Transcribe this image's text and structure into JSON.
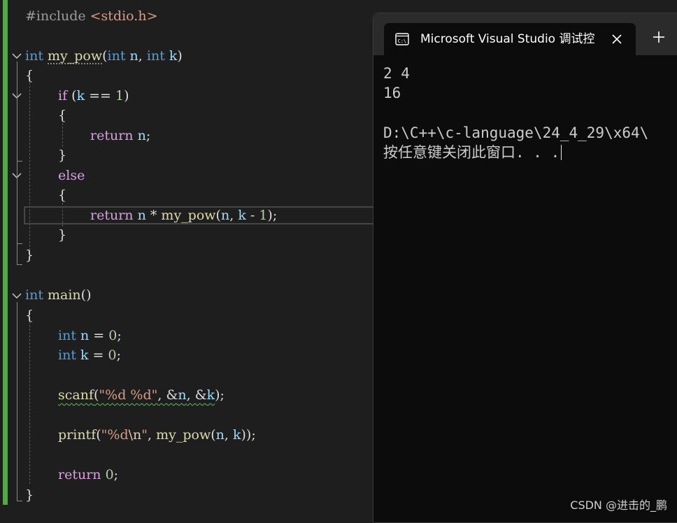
{
  "editor": {
    "lines": {
      "l1": {
        "a": "#include ",
        "b": "<stdio.h>"
      },
      "l3": {
        "a": "int",
        "b": " ",
        "c": "my_pow",
        "d": "(",
        "e": "int",
        "f": " ",
        "g": "n",
        "h": ", ",
        "i": "int",
        "j": " ",
        "k": "k",
        "l": ")"
      },
      "l4": {
        "a": "{"
      },
      "l5": {
        "a": "if",
        "b": " (",
        "c": "k",
        "d": " == ",
        "e": "1",
        "f": ")"
      },
      "l6": {
        "a": "{"
      },
      "l7": {
        "a": "return",
        "b": " ",
        "c": "n",
        "d": ";"
      },
      "l8": {
        "a": "}"
      },
      "l9": {
        "a": "else"
      },
      "l10": {
        "a": "{"
      },
      "l11": {
        "a": "return",
        "b": " ",
        "c": "n",
        "d": " * ",
        "e": "my_pow",
        "f": "(",
        "g": "n",
        "h": ", ",
        "i": "k",
        "j": " - ",
        "k": "1",
        "l": ");"
      },
      "l12": {
        "a": "}"
      },
      "l13": {
        "a": "}"
      },
      "l15": {
        "a": "int",
        "b": " ",
        "c": "main",
        "d": "()"
      },
      "l16": {
        "a": "{"
      },
      "l17": {
        "a": "int",
        "b": " ",
        "c": "n",
        "d": " = ",
        "e": "0",
        "f": ";"
      },
      "l18": {
        "a": "int",
        "b": " ",
        "c": "k",
        "d": " = ",
        "e": "0",
        "f": ";"
      },
      "l20": {
        "a": "scanf",
        "b": "(",
        "c": "\"%d %d\"",
        "d": ", &",
        "e": "n",
        "f": ", &",
        "g": "k",
        "h": ");"
      },
      "l22": {
        "a": "printf",
        "b": "(",
        "c": "\"%d",
        "d": "\\n",
        "e": "\"",
        "f": ", ",
        "g": "my_pow",
        "h": "(",
        "i": "n",
        "j": ", ",
        "k": "k",
        "l": "));"
      },
      "l24": {
        "a": "return",
        "b": " ",
        "c": "0",
        "d": ";"
      },
      "l25": {
        "a": "}"
      }
    },
    "colors": {
      "keyword": "#569cd6",
      "control": "#d8a0df",
      "function": "#dcdcaa",
      "parameter": "#9cdcfe",
      "string": "#d69d85",
      "number": "#b5cea8",
      "change_bar": "#57a64a"
    }
  },
  "console": {
    "tab_title": "Microsoft Visual Studio 调试控制台",
    "tab_icon": "console-app-icon",
    "close_icon": "close-icon",
    "new_tab_icon": "plus-icon",
    "output": {
      "line1": "2 4",
      "line2": "16",
      "line4": "D:\\C++\\c-language\\24_4_29\\x64\\",
      "line5": "按任意键关闭此窗口. . ."
    }
  },
  "watermark": "CSDN @进击的_鹏"
}
